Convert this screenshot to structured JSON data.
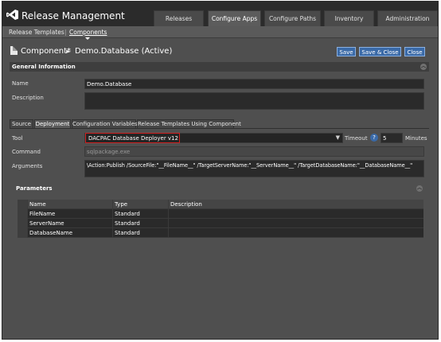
{
  "app": {
    "title": "Release Management"
  },
  "top_tabs": [
    {
      "label": "Releases"
    },
    {
      "label": "Configure Apps"
    },
    {
      "label": "Configure Paths"
    },
    {
      "label": "Inventory"
    },
    {
      "label": "Administration"
    }
  ],
  "sub_nav": {
    "release_templates": "Release Templates",
    "separator": "|",
    "components": "Components"
  },
  "header": {
    "breadcrumb": "Component*",
    "arrow": "►",
    "name": "Demo.Database (Active)",
    "buttons": {
      "save": "Save",
      "save_close": "Save & Close",
      "close": "Close"
    }
  },
  "general": {
    "title": "General Information",
    "name_label": "Name",
    "name_value": "Demo.Database",
    "description_label": "Description",
    "description_value": ""
  },
  "sub_tabs": [
    {
      "label": "Source"
    },
    {
      "label": "Deployment"
    },
    {
      "label": "Configuration Variables"
    },
    {
      "label": "Release Templates Using Component"
    }
  ],
  "deployment": {
    "tool_label": "Tool",
    "tool_value": "DACPAC Database Deployer v12",
    "timeout_label": "Timeout",
    "help_glyph": "?",
    "timeout_value": "5",
    "minutes_label": "Minutes",
    "command_label": "Command",
    "command_value": "sqlpackage.exe",
    "arguments_label": "Arguments",
    "arguments_value": "\\Action:Publish /SourceFile:\"__FileName__\" /TargetServerName:\"__ServerName__\" /TargetDatabaseName:\"__DatabaseName__\""
  },
  "parameters": {
    "title": "Parameters",
    "columns": [
      "Name",
      "Type",
      "Description"
    ],
    "rows": [
      {
        "name": "FileName",
        "type": "Standard",
        "description": ""
      },
      {
        "name": "ServerName",
        "type": "Standard",
        "description": ""
      },
      {
        "name": "DatabaseName",
        "type": "Standard",
        "description": ""
      }
    ]
  },
  "icons": {
    "logo": "visual-studio-logo-icon",
    "document": "document-icon",
    "collapse": "collapse-up-icon",
    "dropdown": "chevron-down-icon",
    "help": "help-icon"
  },
  "colors": {
    "accent": "#3a6aa8",
    "highlight": "#d02020",
    "background": "#4f4f4f"
  }
}
